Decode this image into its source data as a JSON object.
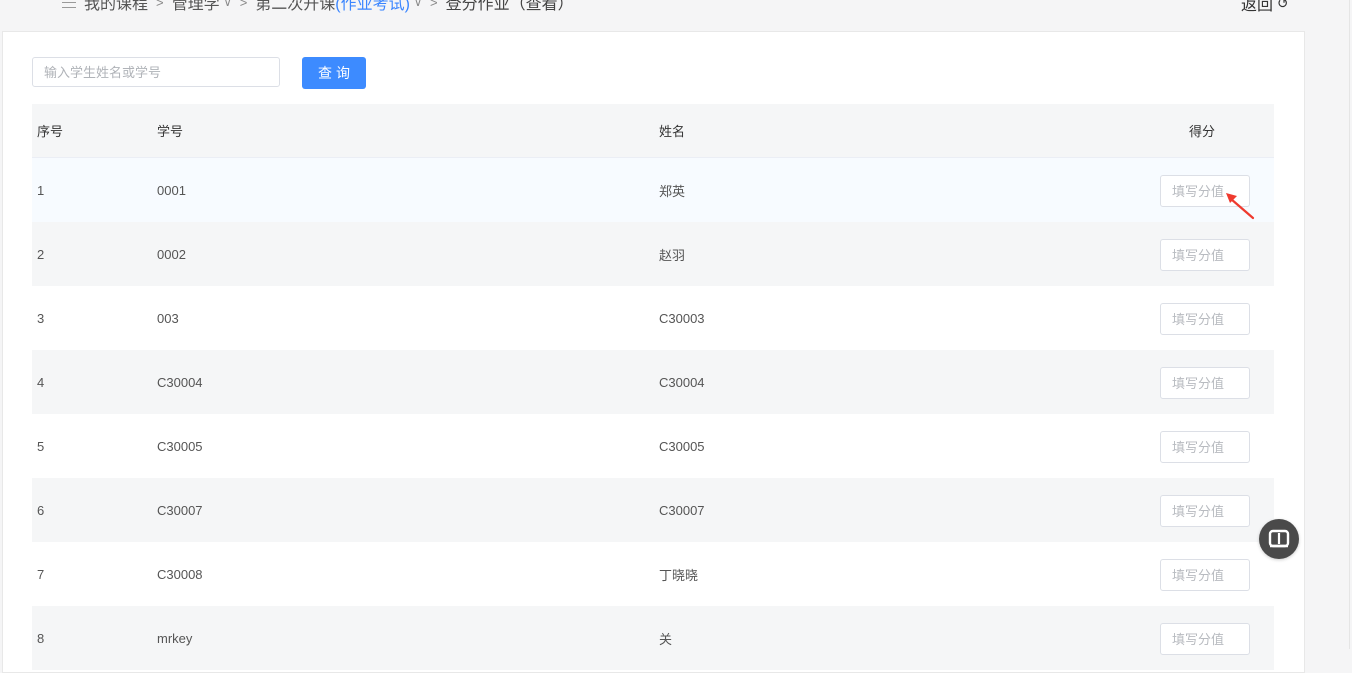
{
  "breadcrumb": {
    "items": [
      {
        "label": "我的课程",
        "style": "normal",
        "dropdown": false
      },
      {
        "label": "管理学",
        "style": "normal",
        "dropdown": true
      },
      {
        "label_prefix": "第二次开课",
        "label_highlight": "(作业考试)",
        "dropdown": true
      },
      {
        "label": "登分作业（查看）",
        "style": "current",
        "dropdown": false
      }
    ],
    "back_label": "返回"
  },
  "search": {
    "placeholder": "输入学生姓名或学号",
    "value": "",
    "button_label": "查询"
  },
  "table": {
    "headers": {
      "index": "序号",
      "student_id": "学号",
      "name": "姓名",
      "score": "得分"
    },
    "score_placeholder": "填写分值",
    "rows": [
      {
        "index": "1",
        "student_id": "0001",
        "name": "郑英"
      },
      {
        "index": "2",
        "student_id": "0002",
        "name": "赵羽"
      },
      {
        "index": "3",
        "student_id": "003",
        "name": "C30003"
      },
      {
        "index": "4",
        "student_id": "C30004",
        "name": "C30004"
      },
      {
        "index": "5",
        "student_id": "C30005",
        "name": "C30005"
      },
      {
        "index": "6",
        "student_id": "C30007",
        "name": "C30007"
      },
      {
        "index": "7",
        "student_id": "C30008",
        "name": "丁晓晓"
      },
      {
        "index": "8",
        "student_id": "mrkey",
        "name": "关"
      }
    ]
  },
  "colors": {
    "accent": "#3d8bff",
    "annotation_arrow": "#ef3a2e",
    "float_button": "#4a4a4a"
  },
  "icons": {
    "menu": "menu-icon",
    "back": "return-icon",
    "float": "book-icon"
  }
}
